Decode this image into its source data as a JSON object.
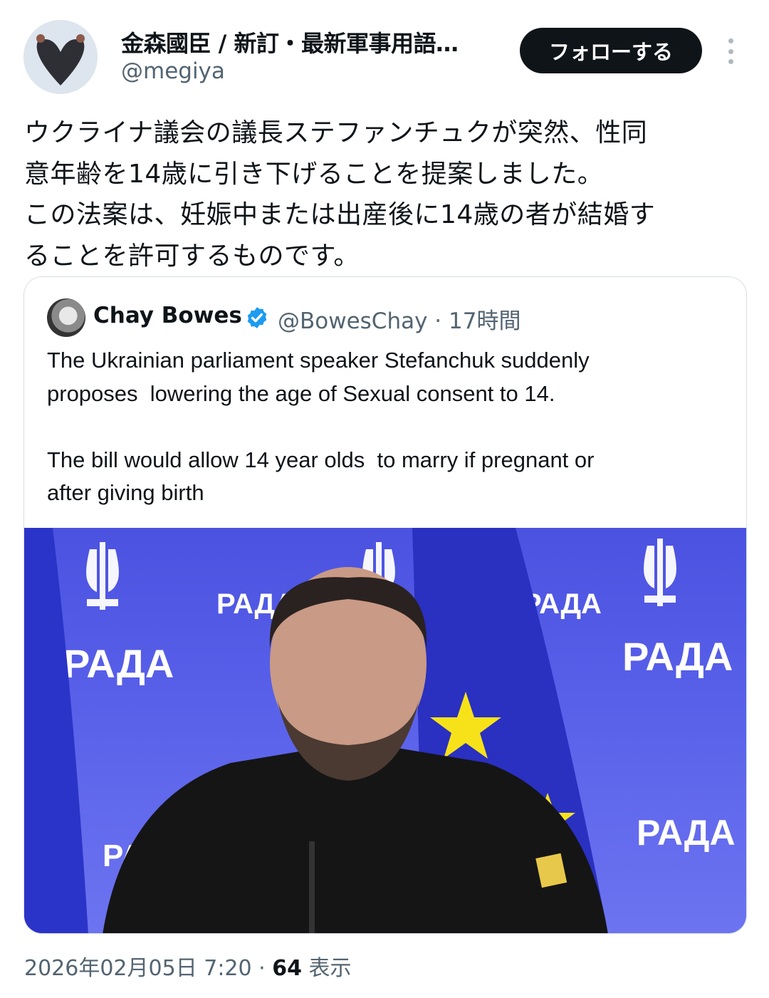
{
  "author": {
    "name": "金森國臣 / 新訂・最新軍事用語…",
    "handle": "@megiya"
  },
  "follow_button": {
    "label": "フォローする"
  },
  "tweet": {
    "text": "ウクライナ議会の議長ステファンチュクが突然、性同\n意年齢を14歳に引き下げることを提案しました。\nこの法案は、妊娠中または出産後に14歳の者が結婚す\nることを許可するものです。"
  },
  "quote": {
    "name": "Chay Bowes",
    "handle": "@BowesChay · 17時間",
    "text": "The Ukrainian parliament speaker Stefanchuk suddenly\nproposes  lowering the age of Sexual consent to 14.\n\nThe bill would allow 14 year olds  to marry if pregnant or\nafter giving birth",
    "photo": {
      "backdrop_labels": [
        "РАДА",
        "РАДА",
        "РАДА",
        "РАДА",
        "РАДА",
        "РАДА"
      ]
    }
  },
  "meta": {
    "timestamp": "2026年02月05日 7:20",
    "separator": " · ",
    "views_count": "64",
    "views_label": " 表示"
  },
  "colors": {
    "text": "#0f1419",
    "secondary": "#536471",
    "verified": "#1d9bf0",
    "photo_blue": "#5961ea",
    "eu_star": "#f7e21a"
  }
}
